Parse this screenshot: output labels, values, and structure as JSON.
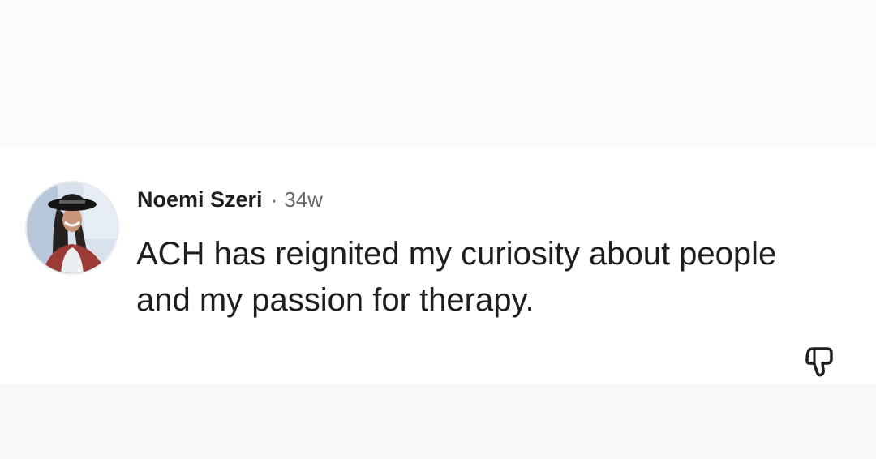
{
  "review": {
    "author": "Noemi Szeri",
    "separator": "·",
    "timestamp": "34w",
    "text": "ACH has reignited my curiosity about people and my passion for therapy.",
    "avatar_icon": "profile-photo",
    "action_icon": "thumbs-down-icon"
  },
  "colors": {
    "background": "#f7f8fa",
    "card": "#ffffff",
    "text_primary": "#1c1e21",
    "text_secondary": "#65676b"
  }
}
